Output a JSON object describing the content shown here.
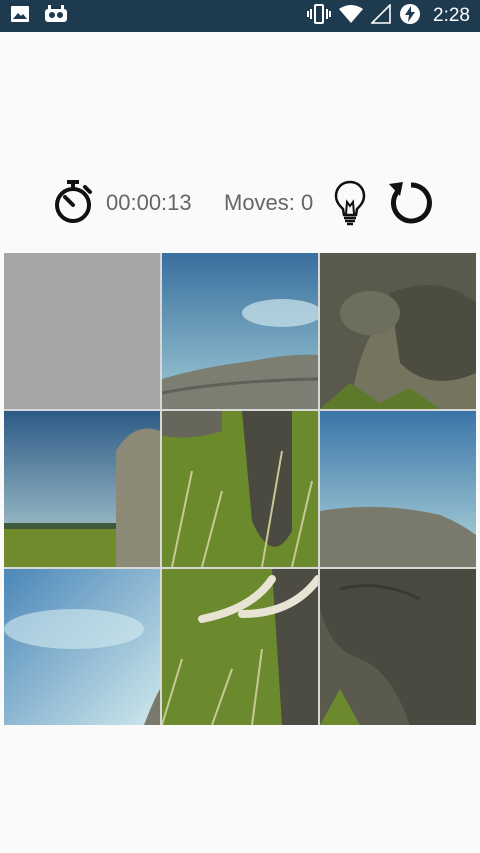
{
  "status_bar": {
    "time": "2:28",
    "icons": [
      "image-icon",
      "robot-icon",
      "vibrate-icon",
      "wifi-icon",
      "signal-icon",
      "battery-charging-icon"
    ]
  },
  "game": {
    "timer": "00:00:13",
    "moves": "Moves: 0",
    "hint_icon": "lightbulb-icon",
    "restart_icon": "restart-icon",
    "timer_icon": "stopwatch-icon"
  },
  "board": {
    "rows": 3,
    "cols": 3,
    "empty_position": 0,
    "tiles": [
      {
        "position": 0,
        "content": "empty"
      },
      {
        "position": 1,
        "content": "sky-elephant-back"
      },
      {
        "position": 2,
        "content": "elephant-head-ear"
      },
      {
        "position": 3,
        "content": "sky-grass-elephant-edge"
      },
      {
        "position": 4,
        "content": "elephant-legs-grass"
      },
      {
        "position": 5,
        "content": "sky-elephant-back-right"
      },
      {
        "position": 6,
        "content": "sky-clouds"
      },
      {
        "position": 7,
        "content": "elephant-tusks-grass"
      },
      {
        "position": 8,
        "content": "elephant-body-grass"
      }
    ]
  },
  "colors": {
    "status_bar": "#1e3a4f",
    "empty_tile": "#a6a6a6",
    "text": "#666666",
    "background": "#fafafa"
  }
}
